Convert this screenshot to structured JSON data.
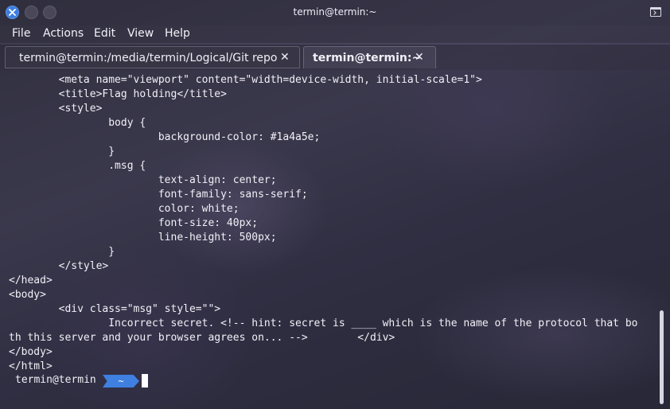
{
  "window": {
    "title": "termin@termin:~"
  },
  "menu": {
    "items": [
      "File",
      "Actions",
      "Edit",
      "View",
      "Help"
    ]
  },
  "tabs": [
    {
      "label": "termin@termin:/media/termin/Logical/Git repo",
      "close": "✕",
      "active": false
    },
    {
      "label": "termin@termin:~",
      "close": "✕",
      "active": true
    }
  ],
  "terminal": {
    "lines": [
      "        <meta name=\"viewport\" content=\"width=device-width, initial-scale=1\">",
      "        <title>Flag holding</title>",
      "        <style>",
      "                body {",
      "                        background-color: #1a4a5e;",
      "                }",
      "                .msg {",
      "                        text-align: center;",
      "                        font-family: sans-serif;",
      "                        color: white;",
      "                        font-size: 40px;",
      "                        line-height: 500px;",
      "                }",
      "        </style>",
      "</head>",
      "<body>",
      "        <div class=\"msg\" style=\"\">",
      "                Incorrect secret. <!-- hint: secret is ____ which is the name of the protocol that bo",
      "th this server and your browser agrees on... -->        </div>",
      "</body>",
      "</html>"
    ],
    "prompt_user": "termin@termin",
    "prompt_dir": "~"
  }
}
